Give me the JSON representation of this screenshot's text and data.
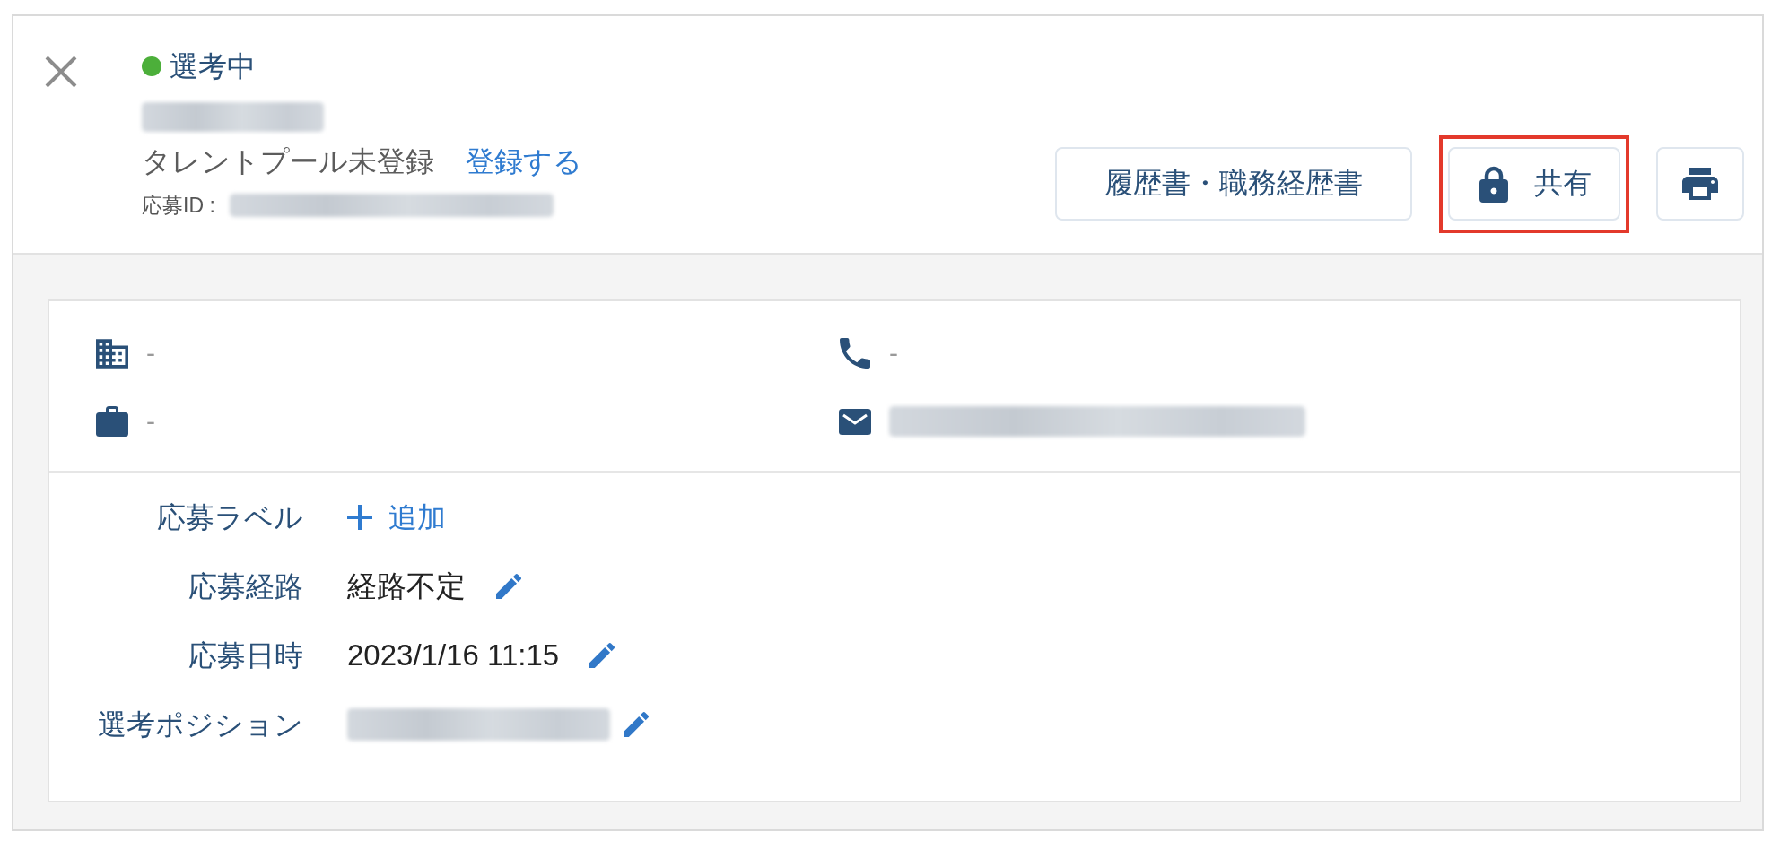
{
  "status": {
    "label": "選考中",
    "color": "#4caf3a"
  },
  "name": {
    "redacted": true
  },
  "talent_pool": {
    "text": "タレントプール未登録",
    "link": "登録する"
  },
  "application_id": {
    "label": "応募ID :",
    "redacted": true
  },
  "actions": [
    {
      "kind": "text",
      "label": "履歴書・職務経歴書",
      "highlighted": false
    },
    {
      "kind": "locked",
      "label": "共有",
      "highlighted": true
    },
    {
      "kind": "print",
      "highlighted": false
    }
  ],
  "contacts": [
    {
      "kind": "company",
      "value": "-",
      "redacted": false
    },
    {
      "kind": "phone",
      "value": "-",
      "redacted": false
    },
    {
      "kind": "job",
      "value": "-",
      "redacted": false
    },
    {
      "kind": "email",
      "redacted": true
    }
  ],
  "details": [
    {
      "kind": "add",
      "label": "応募ラベル",
      "action": "追加"
    },
    {
      "kind": "value",
      "label": "応募経路",
      "value": "経路不定",
      "redacted": false,
      "editable": true
    },
    {
      "kind": "value",
      "label": "応募日時",
      "value": "2023/1/16 11:15",
      "redacted": false,
      "editable": true
    },
    {
      "kind": "value",
      "label": "選考ポジション",
      "redacted": true,
      "editable": true
    }
  ]
}
